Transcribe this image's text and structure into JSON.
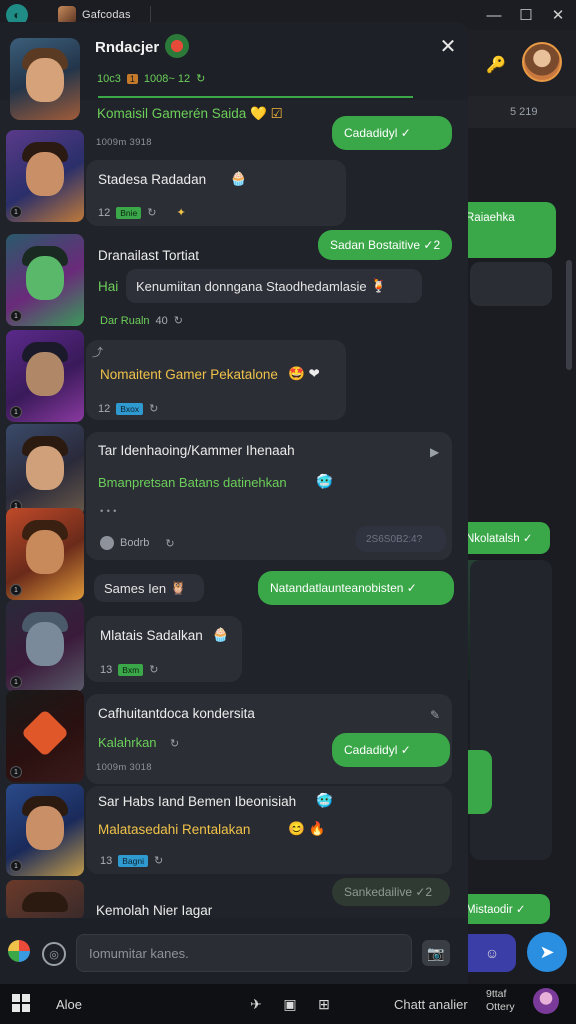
{
  "window": {
    "tab_title": "Gafcodas",
    "minimize": "—",
    "maximize": "☐",
    "close": "✕"
  },
  "header": {
    "name": "Rndacjer",
    "status": "10c3",
    "badge": "1",
    "status_extra": "1008~ 12",
    "close": "✕"
  },
  "group_title": "Komaisil Gamerén Saida",
  "group_title_emoji": "💛 ☑",
  "background": {
    "subtext": "5 219",
    "bubbles": [
      "Raiaehka",
      "Nkolatalsh ✓",
      "Mistaodir ✓"
    ]
  },
  "messages": [
    {
      "timestamp": "1009m 3918",
      "bubble": "Cadadidyl ✓"
    },
    {
      "text": "Stadesa Radadan",
      "emoji": "🧁",
      "count": "12",
      "tag": "Bnie",
      "icon": "✦"
    },
    {
      "bubble": "Sadan Bostaitive ✓2"
    },
    {
      "title": "Dranailast Tortiat",
      "label_green": "Hai",
      "pill": "Kenumiitan donngana Staodhedamlasie",
      "pill_emoji": "🍹",
      "meta": "Dar Rualn",
      "meta_count": "40"
    },
    {
      "text": "Nomaitent Gamer Pekatalone",
      "emoji": "🤩 ❤",
      "count": "12",
      "tag": "Bxox"
    },
    {
      "title": "Tar Idenhaoing/Kammer Ihenaah",
      "subtitle": "Bmanpretsan Batans datinehkan",
      "subtitle_emoji": "🥶",
      "dots": "• • •",
      "meta": "Bodrb",
      "stamp": "2S6S0B2:4?"
    },
    {
      "pill": "Sames Ien",
      "pill_emoji": "🦉",
      "bubble": "Natandatlaunteanobisten ✓"
    },
    {
      "text": "Mlatais Sadalkan",
      "emoji": "🧁",
      "count": "13",
      "tag": "Bxm"
    },
    {
      "title": "Cafhuitantdoca kondersita",
      "label_green": "Kalahrkan",
      "timestamp": "1009m 3018",
      "bubble": "Cadadidyl ✓"
    },
    {
      "text": "Sar Habs Iand Bemen Ibeonisiah",
      "emoji": "🥶",
      "text2": "Malatasedahi Rentalakan",
      "emoji2": "😊 🔥",
      "count": "13",
      "tag": "Bagni"
    },
    {
      "bubble": "Sankedailive ✓2",
      "title": "Kemolah Nier Iagar"
    }
  ],
  "compose": {
    "placeholder": "Iomumitar kanes."
  },
  "taskbar": {
    "left_label": "Aloe",
    "right_label": "Chatt analier",
    "clock_line1": "9ttaf",
    "clock_line2": "Ottery"
  },
  "colors": {
    "accent_green": "#3aa849",
    "text_green": "#6ccf5a",
    "panel_bg": "#202329",
    "card_bg": "#2b2e35",
    "send_blue": "#2a8fe0"
  }
}
